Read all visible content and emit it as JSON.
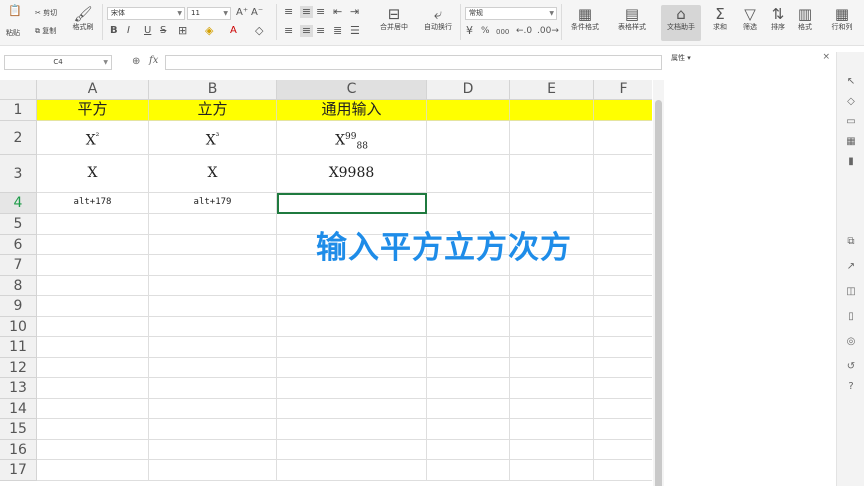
{
  "ribbon": {
    "paste": "粘贴",
    "cut": "剪切",
    "copy": "复制",
    "format_painter": "格式刷",
    "font_name": "宋体",
    "font_size": "11",
    "bold": "B",
    "italic": "I",
    "underline": "U",
    "strike": "S",
    "merge_center": "合并居中",
    "wrap_text": "自动换行",
    "number_format": "常规",
    "percent": "%",
    "thousands": "000",
    "conditional_format": "条件格式",
    "table_style": "表格样式",
    "doc_assistant": "文档助手",
    "sum": "求和",
    "filter": "筛选",
    "sort": "排序",
    "format": "格式",
    "rows_cols": "行和列"
  },
  "formula_bar": {
    "name_box": "C4",
    "fx": "fx",
    "value": ""
  },
  "pane": {
    "title": "属性"
  },
  "columns": [
    "A",
    "B",
    "C",
    "D",
    "E",
    "F"
  ],
  "rows": [
    "1",
    "2",
    "3",
    "4",
    "5",
    "6",
    "7",
    "8",
    "9",
    "10",
    "11",
    "12",
    "13",
    "14",
    "15",
    "16",
    "17"
  ],
  "cells": {
    "A1": "平方",
    "B1": "立方",
    "C1": "通用输入",
    "A2": {
      "base": "X",
      "sup": "²"
    },
    "B2": {
      "base": "X",
      "sup": "³"
    },
    "C2": {
      "base": "X",
      "sup": "99",
      "sub": "88"
    },
    "A3": "X",
    "B3": "X",
    "C3": "X9988",
    "A4": "alt+178",
    "B4": "alt+179"
  },
  "overlay_text": "输入平方立方次方",
  "colors": {
    "header_fill": "#ffff00",
    "overlay": "#1e8ce8",
    "selection": "#1f7a3f"
  }
}
